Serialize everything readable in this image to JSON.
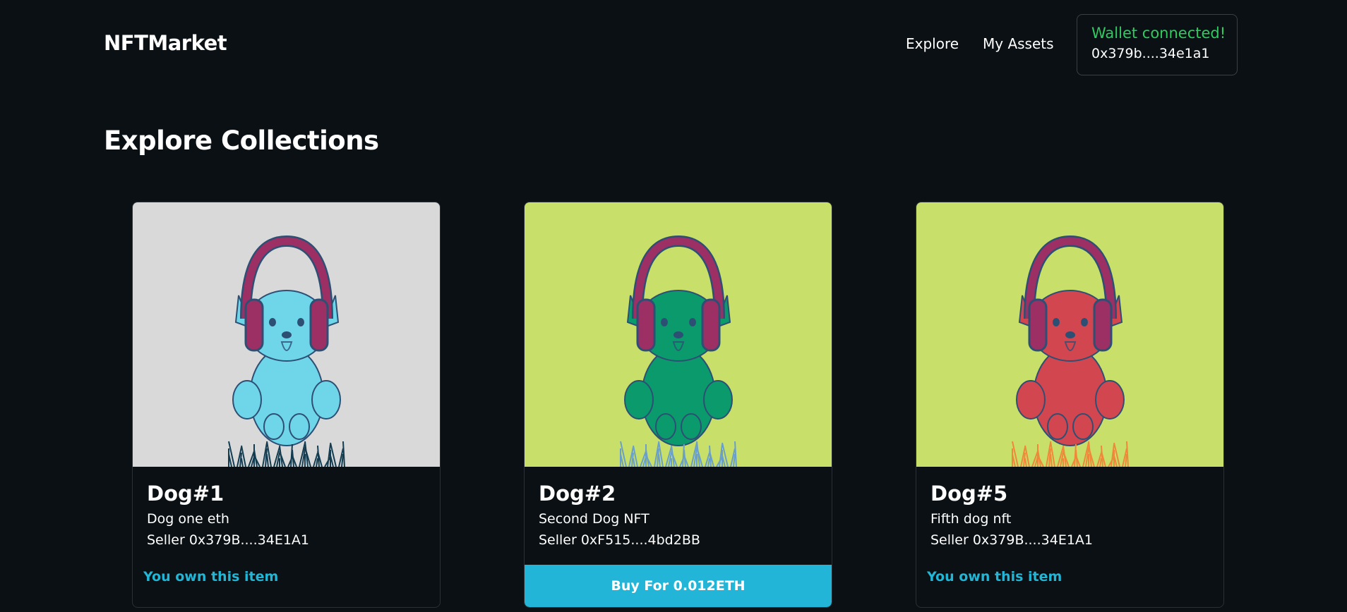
{
  "header": {
    "brand": "NFTMarket",
    "nav": {
      "explore": "Explore",
      "my_assets": "My Assets"
    },
    "wallet": {
      "status": "Wallet connected!",
      "address": "0x379b....34e1a1",
      "status_color": "#2ecc5f"
    }
  },
  "main": {
    "title": "Explore Collections",
    "cards": [
      {
        "name": "Dog#1",
        "description": "Dog one eth",
        "seller": "Seller 0x379B....34E1A1",
        "action": "You own this item",
        "action_type": "owned",
        "bg_color": "#d9d9da",
        "dog_color": "#6fd6ea",
        "grass_color": "#133c50"
      },
      {
        "name": "Dog#2",
        "description": "Second Dog NFT",
        "seller": "Seller 0xF515....4bd2BB",
        "action": "Buy For 0.012ETH",
        "action_type": "buy",
        "bg_color": "#c8df6a",
        "dog_color": "#0a9a6c",
        "grass_color": "#6aa0c8"
      },
      {
        "name": "Dog#5",
        "description": "Fifth dog nft",
        "seller": "Seller 0x379B....34E1A1",
        "action": "You own this item",
        "action_type": "owned",
        "bg_color": "#c8df6a",
        "dog_color": "#d24650",
        "grass_color": "#f0883a"
      }
    ]
  },
  "colors": {
    "background": "#0a1014",
    "accent": "#22b5d7",
    "headphones": "#9c2f63"
  }
}
